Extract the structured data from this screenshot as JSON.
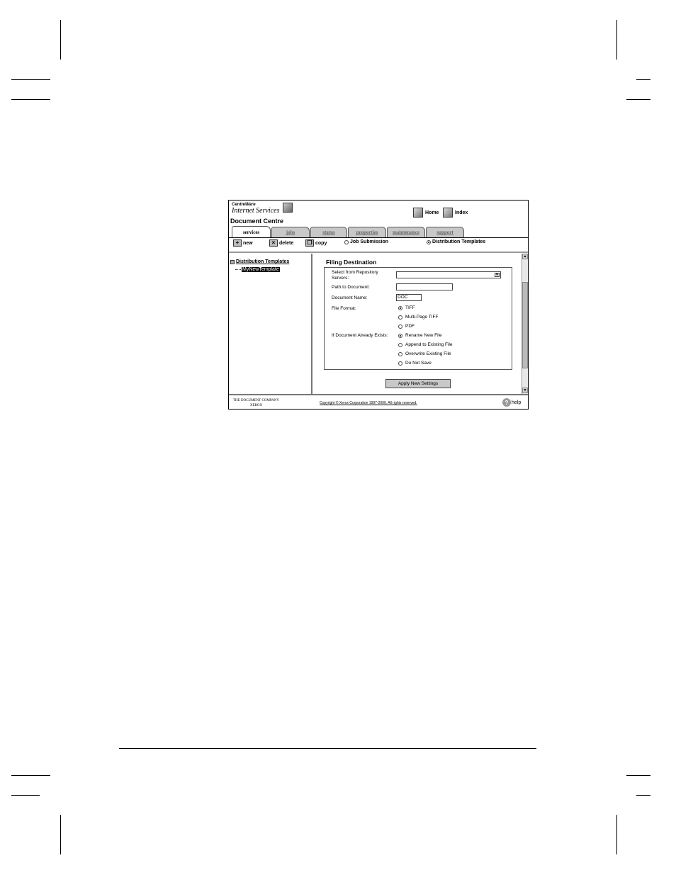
{
  "brand": {
    "product_line1": "CentreWare",
    "product_line2": "Internet Services",
    "device_name": "Document Centre"
  },
  "top_links": [
    {
      "label": "Home",
      "icon": "home-icon"
    },
    {
      "label": "Index",
      "icon": "index-icon"
    }
  ],
  "tabs": [
    {
      "label": "services",
      "active": true
    },
    {
      "label": "jobs",
      "active": false
    },
    {
      "label": "status",
      "active": false
    },
    {
      "label": "properties",
      "active": false
    },
    {
      "label": "maintenance",
      "active": false
    },
    {
      "label": "support",
      "active": false
    }
  ],
  "toolbar": {
    "new_label": "new",
    "delete_label": "delete",
    "copy_label": "copy",
    "mode_job_submission": "Job Submission",
    "mode_distribution_templates": "Distribution Templates",
    "selected_mode": "Distribution Templates"
  },
  "tree": {
    "root_label": "Distribution Templates",
    "child_label": "MyNewTemplate"
  },
  "form": {
    "title": "Filing Destination",
    "repository_label": "Select from Repository Servers:",
    "repository_value": "",
    "path_label": "Path to Document:",
    "path_value": "",
    "name_label": "Document Name:",
    "name_value": "DOC",
    "format_label": "File Format:",
    "format_options": [
      "TIFF",
      "Multi-Page TIFF",
      "PDF"
    ],
    "format_selected": "TIFF",
    "exists_label": "If Document Already Exists:",
    "exists_options": [
      "Rename New File",
      "Append to Existing File",
      "Overwrite Existing File",
      "Do Not Save"
    ],
    "exists_selected": "Rename New File",
    "apply_label": "Apply New Settings"
  },
  "footer": {
    "company_line1": "THE DOCUMENT COMPANY",
    "company_line2": "XEROX",
    "copyright": "Copyright © Xerox Corporation 1997-2000. All rights reserved.",
    "help_label": "help"
  }
}
